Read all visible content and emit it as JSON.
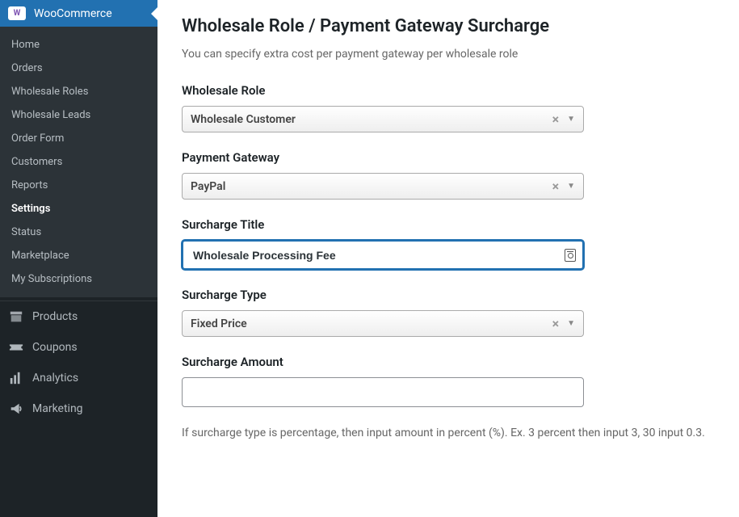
{
  "sidebar": {
    "active_label": "WooCommerce",
    "submenu": [
      {
        "label": "Home"
      },
      {
        "label": "Orders"
      },
      {
        "label": "Wholesale Roles"
      },
      {
        "label": "Wholesale Leads"
      },
      {
        "label": "Order Form"
      },
      {
        "label": "Customers"
      },
      {
        "label": "Reports"
      },
      {
        "label": "Settings",
        "current": true
      },
      {
        "label": "Status"
      },
      {
        "label": "Marketplace"
      },
      {
        "label": "My Subscriptions"
      }
    ],
    "menu": [
      {
        "label": "Products",
        "icon": "archive"
      },
      {
        "label": "Coupons",
        "icon": "ticket"
      },
      {
        "label": "Analytics",
        "icon": "stats"
      },
      {
        "label": "Marketing",
        "icon": "megaphone"
      }
    ]
  },
  "page": {
    "title": "Wholesale Role / Payment Gateway Surcharge",
    "description": "You can specify extra cost per payment gateway per wholesale role"
  },
  "form": {
    "wholesale_role_label": "Wholesale Role",
    "wholesale_role_value": "Wholesale Customer",
    "payment_gateway_label": "Payment Gateway",
    "payment_gateway_value": "PayPal",
    "surcharge_title_label": "Surcharge Title",
    "surcharge_title_value": "Wholesale Processing Fee",
    "surcharge_type_label": "Surcharge Type",
    "surcharge_type_value": "Fixed Price",
    "surcharge_amount_label": "Surcharge Amount",
    "surcharge_amount_value": "",
    "help_text": "If surcharge type is percentage, then input amount in percent (%). Ex. 3 percent then input 3, 30 input 0.3."
  }
}
